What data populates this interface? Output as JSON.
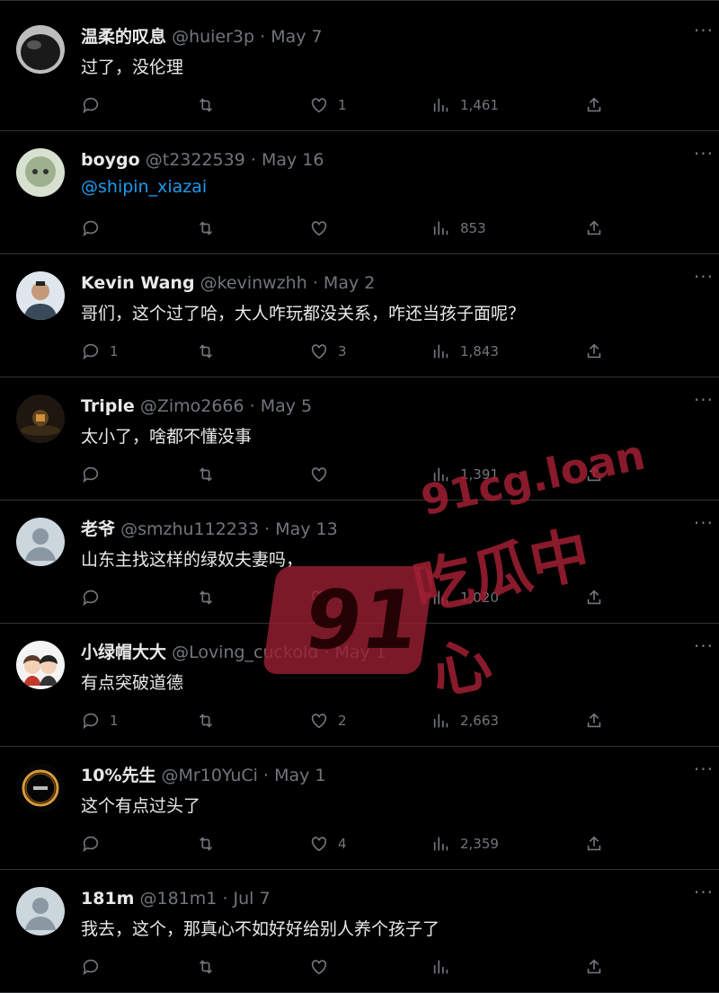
{
  "tweets": [
    {
      "name": "温柔的叹息",
      "handle": "@huier3p",
      "date": "May 7",
      "text": "过了，没伦理",
      "is_link": false,
      "replies": "",
      "retweets": "",
      "likes": "1",
      "views": "1,461",
      "avatar_color": "#3a3a3a"
    },
    {
      "name": "boygo",
      "handle": "@t2322539",
      "date": "May 16",
      "text": "@shipin_xiazai",
      "is_link": true,
      "replies": "",
      "retweets": "",
      "likes": "",
      "views": "853",
      "avatar_color": "#b8c4b0"
    },
    {
      "name": "Kevin Wang",
      "handle": "@kevinwzhh",
      "date": "May 2",
      "text": "哥们，这个过了哈，大人咋玩都没关系，咋还当孩子面呢？",
      "is_link": false,
      "replies": "1",
      "retweets": "",
      "likes": "3",
      "views": "1,843",
      "avatar_color": "#c9d2dc"
    },
    {
      "name": "Triple",
      "handle": "@Zimo2666",
      "date": "May 5",
      "text": "太小了，啥都不懂没事",
      "is_link": false,
      "replies": "",
      "retweets": "",
      "likes": "",
      "views": "1,391",
      "avatar_color": "#2b2118"
    },
    {
      "name": "老爷",
      "handle": "@smzhu112233",
      "date": "May 13",
      "text": "山东主找这样的绿奴夫妻吗，",
      "is_link": false,
      "replies": "",
      "retweets": "",
      "likes": "1",
      "views": "1,020",
      "avatar_color": "#ccd6dd"
    },
    {
      "name": "小绿帽大大",
      "handle": "@Loving_cuckold",
      "date": "May 1",
      "text": "有点突破道德",
      "is_link": false,
      "replies": "1",
      "retweets": "",
      "likes": "2",
      "views": "2,663",
      "avatar_color": "#f4f4f4"
    },
    {
      "name": "10%先生",
      "handle": "@Mr10YuCi",
      "date": "May 1",
      "text": "这个有点过头了",
      "is_link": false,
      "replies": "",
      "retweets": "",
      "likes": "4",
      "views": "2,359",
      "avatar_color": "#0a0a0a"
    },
    {
      "name": "181m",
      "handle": "@181m1",
      "date": "Jul 7",
      "text": "我去，这个，那真心不如好好给别人养个孩子了",
      "is_link": false,
      "replies": "",
      "retweets": "",
      "likes": "",
      "views": "",
      "avatar_color": "#ccd6dd"
    }
  ],
  "dot": "·",
  "more_glyph": "···",
  "watermark": {
    "number": "91",
    "site": "91cg.loan",
    "name": "吃瓜中心"
  },
  "colors": {
    "background": "#000000",
    "text": "#e7e9ea",
    "muted": "#71767b",
    "link": "#1d9bf0",
    "divider": "#2f3336",
    "watermark": "#a01e32"
  }
}
